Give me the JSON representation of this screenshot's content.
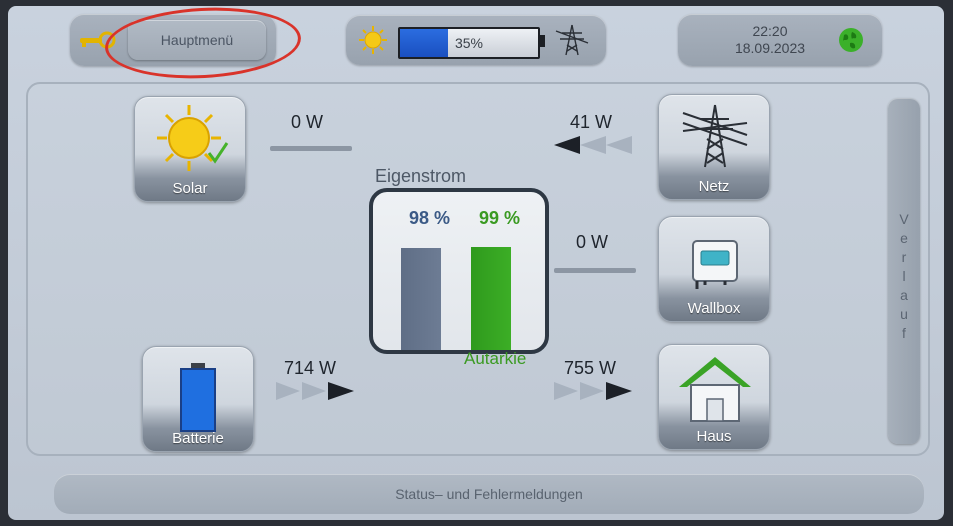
{
  "header": {
    "menu_label": "Hauptmenü",
    "battery_percent_text": "35%",
    "battery_level": 0.35,
    "time": "22:20",
    "date": "18.09.2023"
  },
  "flows": {
    "solar": {
      "label": "Solar",
      "watts": "0 W"
    },
    "netz": {
      "label": "Netz",
      "watts": "41 W"
    },
    "wallbox": {
      "label": "Wallbox",
      "watts": "0 W"
    },
    "batterie": {
      "label": "Batterie",
      "watts": "714 W"
    },
    "haus": {
      "label": "Haus",
      "watts": "755 W"
    }
  },
  "center": {
    "title": "Eigenstrom",
    "eigenstrom_pct": "98 %",
    "autarkie_pct": "99 %",
    "eigenstrom_level": 0.98,
    "autarkie_level": 0.99,
    "autarkie_label": "Autarkie"
  },
  "side": {
    "verlauf_label": "V\ne\nr\nl\na\nu\nf"
  },
  "footer": {
    "status_label": "Status– und Fehlermeldungen"
  },
  "colors": {
    "accent_green": "#3a9a22",
    "battery_blue": "#1a4fc0",
    "highlight_red": "#d9332a"
  }
}
